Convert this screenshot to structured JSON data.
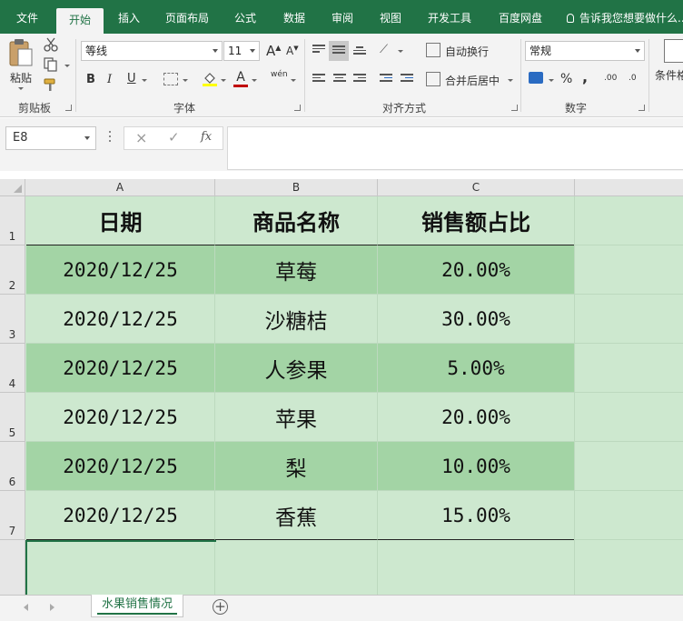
{
  "ribbon": {
    "tabs": [
      {
        "label": "文件",
        "active": false
      },
      {
        "label": "开始",
        "active": true
      },
      {
        "label": "插入",
        "active": false
      },
      {
        "label": "页面布局",
        "active": false
      },
      {
        "label": "公式",
        "active": false
      },
      {
        "label": "数据",
        "active": false
      },
      {
        "label": "审阅",
        "active": false
      },
      {
        "label": "视图",
        "active": false
      },
      {
        "label": "开发工具",
        "active": false
      },
      {
        "label": "百度网盘",
        "active": false
      }
    ],
    "tell_me": "告诉我您想要做什么...",
    "clipboard": {
      "paste_label": "粘贴",
      "group_label": "剪贴板"
    },
    "font": {
      "name": "等线",
      "size": "11",
      "group_label": "字体",
      "bold": "B",
      "italic": "I",
      "underline": "U",
      "wen": "wén",
      "grow": "A",
      "shrink": "A",
      "font_color_letter": "A"
    },
    "alignment": {
      "wrap_text": "自动换行",
      "merge_center": "合并后居中",
      "group_label": "对齐方式"
    },
    "number": {
      "format": "常规",
      "percent": "%",
      "comma": ",",
      "inc_decimal": ".00",
      "dec_decimal": ".0",
      "group_label": "数字"
    },
    "styles": {
      "conditional_format": "条件格式"
    },
    "colors": {
      "accent": "#217346",
      "fill_highlight": "#ffff00",
      "font_color": "#c00000"
    }
  },
  "formula_bar": {
    "name_box": "E8",
    "fx": "fx",
    "cancel": "×",
    "confirm": "✓",
    "formula": ""
  },
  "grid": {
    "columns": [
      "A",
      "B",
      "C"
    ],
    "rows": [
      "1",
      "2",
      "3",
      "4",
      "5",
      "6",
      "7"
    ],
    "header": [
      "日期",
      "商品名称",
      "销售额占比"
    ],
    "data": [
      [
        "2020/12/25",
        "草莓",
        "20.00%"
      ],
      [
        "2020/12/25",
        "沙糖桔",
        "30.00%"
      ],
      [
        "2020/12/25",
        "人参果",
        "5.00%"
      ],
      [
        "2020/12/25",
        "苹果",
        "20.00%"
      ],
      [
        "2020/12/25",
        "梨",
        "10.00%"
      ],
      [
        "2020/12/25",
        "香蕉",
        "15.00%"
      ]
    ],
    "colors": {
      "band_light": "#cde8cf",
      "band_dark": "#a3d4a5"
    }
  },
  "sheets": {
    "tabs": [
      "水果销售情况"
    ],
    "add_label": "+"
  }
}
